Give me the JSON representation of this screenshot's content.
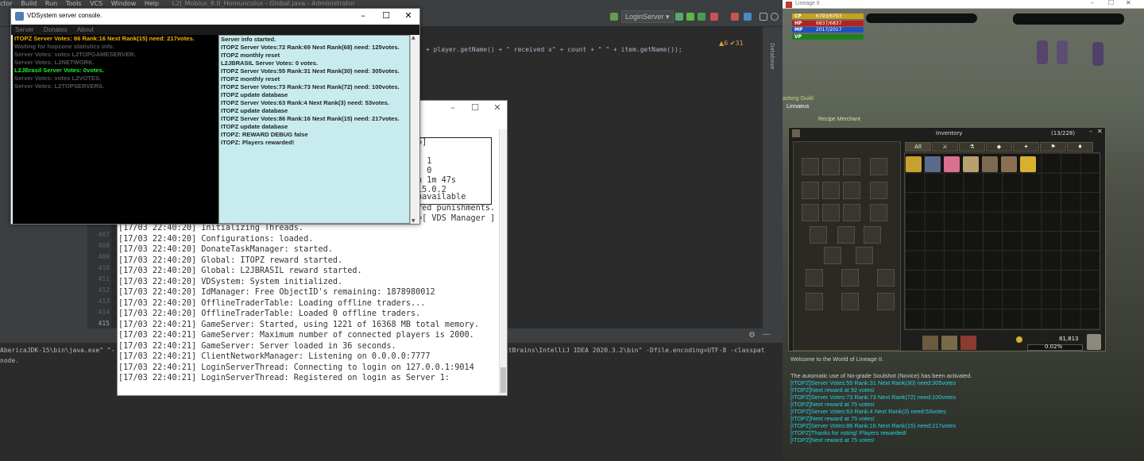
{
  "ide": {
    "menu_items": [
      "ctor",
      "Build",
      "Run",
      "Tools",
      "VCS",
      "Window",
      "Help"
    ],
    "project_title": "L2J_Mobius_8.0_Homunculus - Global.java - Administrator",
    "run_config": "LoginServer",
    "inspections": "▲6 ✔31",
    "database_tab": "Database",
    "code_snippet": "+ player.getName() + \" received x\" + count + \" \" + item.getName());",
    "line_numbers": [
      "407",
      "408",
      "409",
      "410",
      "411",
      "412",
      "413",
      "414",
      "415"
    ],
    "terminal_line_1": "AbericaJDK-15\\bin\\java.exe\" \"-",
    "terminal_line_1b": "etBrains\\IntelliJ IDEA 2020.3.2\\bin\" -Dfile.encoding=UTF-8 -classpat",
    "terminal_line_2": "node."
  },
  "vds_manager": {
    "box_lines": [
      "6]",
      "",
      ": 1",
      ": 0",
      "h 1m 47s",
      " 15.0.2",
      "navailable"
    ],
    "tail_lines": [
      "red punishments.",
      "=[ VDS Manager ]"
    ],
    "log": [
      "[17/03 22:40:20] Initializing Threads.",
      "[17/03 22:40:20] Configurations: loaded.",
      "[17/03 22:40:20] DonateTaskManager: started.",
      "[17/03 22:40:20] Global: ITOPZ reward started.",
      "[17/03 22:40:20] Global: L2JBRASIL reward started.",
      "[17/03 22:40:20] VDSystem: System initialized.",
      "[17/03 22:40:20] IdManager: Free ObjectID's remaining: 1878980012",
      "[17/03 22:40:20] OfflineTraderTable: Loading offline traders...",
      "[17/03 22:40:20] OfflineTraderTable: Loaded 0 offline traders.",
      "[17/03 22:40:21] GameServer: Started, using 1221 of 16368 MB total memory.",
      "[17/03 22:40:21] GameServer: Maximum number of connected players is 2000.",
      "[17/03 22:40:21] GameServer: Server loaded in 36 seconds.",
      "[17/03 22:40:21] ClientNetworkManager: Listening on 0.0.0.0:7777",
      "[17/03 22:40:21] LoginServerThread: Connecting to login on 127.0.0.1:9014",
      "[17/03 22:40:21] LoginServerThread: Registered on login as Server 1:"
    ]
  },
  "console": {
    "title": "VDSystem server console.",
    "menu": [
      "Server",
      "Donates",
      "About"
    ],
    "left_lines": [
      {
        "text": "ITOPZ Server Votes: 86 Rank:16 Next Rank(15) need: 217votes.",
        "color": "#f4b400"
      },
      {
        "text": "Waiting for hopzone statistics info.",
        "color": "#555555"
      },
      {
        "text": "Server Votes: votes L2TOPGAMESERVER.",
        "color": "#555555"
      },
      {
        "text": "Server Votes: L2NETWORK.",
        "color": "#555555"
      },
      {
        "text": "L2JBrasil Server Votes: 0votes.",
        "color": "#22ee22"
      },
      {
        "text": "Server Votes: votes L2VOTES.",
        "color": "#555555"
      },
      {
        "text": "Server Votes: L2TOPSERVERS.",
        "color": "#555555"
      }
    ],
    "right_lines": [
      "Server info started.",
      "ITOPZ Server Votes:72 Rank:69 Next Rank(68) need: 125votes.",
      "ITOPZ monthly reset",
      "L2JBRASIL Server Votes: 0 votes.",
      "ITOPZ Server Votes:55 Rank:31 Next Rank(30) need: 305votes.",
      "ITOPZ monthly reset",
      "ITOPZ Server Votes:73 Rank:73 Next Rank(72) need: 100votes.",
      "ITOPZ update database",
      "ITOPZ Server Votes:63 Rank:4 Next Rank(3) need: 53votes.",
      "ITOPZ update database",
      "ITOPZ Server Votes:86 Rank:16 Next Rank(15) need: 217votes.",
      "ITOPZ update database",
      "ITOPZ: REWARD DEBUG false",
      "ITOPZ: Players rewarded!"
    ]
  },
  "game": {
    "title": "Lineage II",
    "stats": [
      {
        "label": "CP",
        "value": "6793/6793",
        "color": "#c8a020"
      },
      {
        "label": "HP",
        "value": "6837/6837",
        "color": "#b82020"
      },
      {
        "label": "MP",
        "value": "2017/2017",
        "color": "#2050c0"
      },
      {
        "label": "VP",
        "value": "",
        "color": "#208020"
      }
    ],
    "npc_label": "ashing Guild",
    "npc_name": "Linnaeus",
    "npc_title": "Recipe Merchant",
    "inventory": {
      "title": "Inventory",
      "count": "(13/228)",
      "tabs": [
        "All"
      ],
      "adena": "81,813",
      "weight": "0.02%"
    },
    "chat": [
      {
        "text": "Welcome to the World of Lineage II.",
        "color": "#cfcfcf"
      },
      {
        "text": "The automatic use of No-grade Soulshot (Novice) has been activated.",
        "color": "#cfcfcf"
      },
      {
        "text": "[ITOPZ]Server Votes:55 Rank:31 Next Rank(30) need:305votes",
        "color": "#22d3e6"
      },
      {
        "text": "[ITOPZ]Next reward at 92 votes!",
        "color": "#22d3e6"
      },
      {
        "text": "[ITOPZ]Server Votes:73 Rank:73 Next Rank(72) need:100votes",
        "color": "#22d3e6"
      },
      {
        "text": "[ITOPZ]Next reward at 75 votes!",
        "color": "#22d3e6"
      },
      {
        "text": "[ITOPZ]Server Votes:63 Rank:4 Next Rank(3) need:53votes",
        "color": "#22d3e6"
      },
      {
        "text": "[ITOPZ]Next reward at 75 votes!",
        "color": "#22d3e6"
      },
      {
        "text": "[ITOPZ]Server Votes:86 Rank:16 Next Rank(15) need:217votes",
        "color": "#22d3e6"
      },
      {
        "text": "[ITOPZ]Thanks for voting! Players rewarded!",
        "color": "#22d3e6"
      },
      {
        "text": "[ITOPZ]Next reward at 75 votes!",
        "color": "#22d3e6"
      }
    ]
  },
  "colors": {
    "ide_bg": "#2b2b2b",
    "console_right_bg": "#c8ecee",
    "accent_cyan": "#22d3e6"
  }
}
